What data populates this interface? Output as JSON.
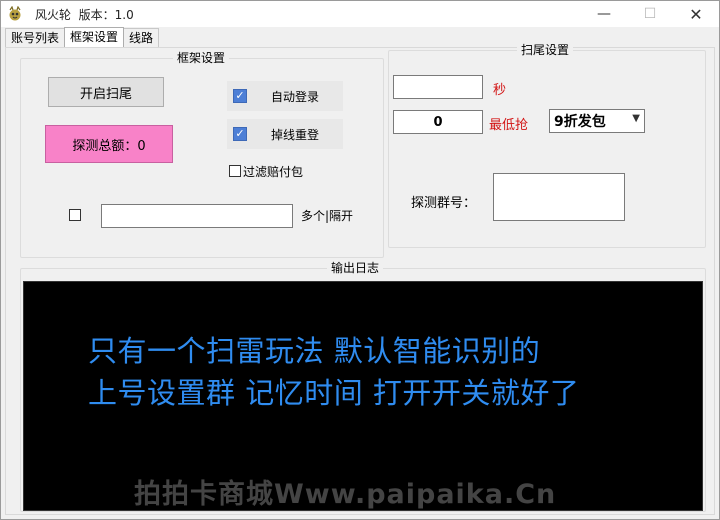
{
  "window": {
    "title": "风火轮  版本：1.0",
    "controls": {
      "minimize": "—",
      "maximize": "☐",
      "close": "✕"
    }
  },
  "tabs": [
    {
      "label": "账号列表",
      "active": false
    },
    {
      "label": "框架设置",
      "active": true
    },
    {
      "label": "线路",
      "active": false
    }
  ],
  "framework": {
    "group_title": "框架设置",
    "start_button": "开启扫尾",
    "probe_total_label": "探测总额：0",
    "auto_login": {
      "label": "自动登录",
      "checked": true
    },
    "reconnect": {
      "label": "掉线重登",
      "checked": true
    },
    "filter_pay": {
      "label": "过滤赔付包",
      "checked": false
    },
    "multi_field": {
      "checked": false,
      "value": "",
      "hint": "多个|隔开"
    }
  },
  "sweep": {
    "group_title": "扫尾设置",
    "seconds_value": "",
    "seconds_unit": "秒",
    "min_grab_value": "0",
    "min_grab_label": "最低抢",
    "discount_selected": "9折发包",
    "probe_group_label": "探测群号：",
    "probe_group_value": ""
  },
  "log": {
    "group_title": "输出日志",
    "lines": [
      "只有一个扫雷玩法 默认智能识别的",
      "上号设置群 记忆时间 打开开关就好了"
    ],
    "watermark": "拍拍卡商城Www.paipaika.Cn"
  },
  "colors": {
    "pink_button": "#f882c8",
    "log_text": "#2f8cf0",
    "log_bg": "#000000",
    "red_label": "#d21414"
  }
}
